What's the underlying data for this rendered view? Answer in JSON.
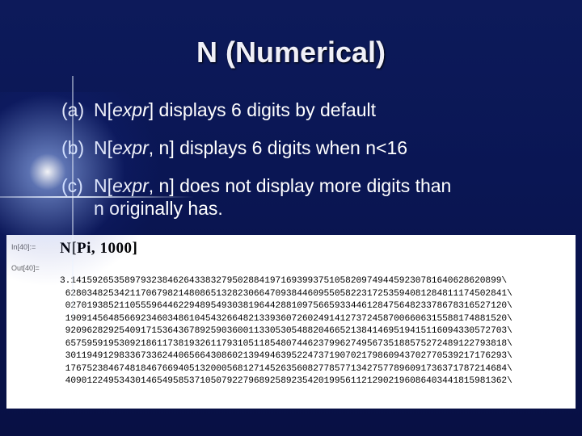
{
  "slide": {
    "title": "N (Numerical)",
    "bullets": {
      "a": {
        "label": "(a)",
        "pre": "N[",
        "expr": "expr",
        "post": "] displays 6 digits by default"
      },
      "b": {
        "label": "(b)",
        "pre": "N[",
        "expr": "expr",
        "post": ", n] displays 6 digits when n<16"
      },
      "c": {
        "label": "(c)",
        "pre": "N[",
        "expr": "expr",
        "post": ", n] does not display more digits than",
        "cont": "n originally has."
      }
    }
  },
  "notebook": {
    "in_label": "In[40]:=",
    "in_code_pre": "N[Pi, ",
    "in_code_n": "1000",
    "in_code_post": "]",
    "out_label": "Out[40]=",
    "out_lines": [
      "3.14159265358979323846264338327950288419716939937510582097494459230781640628620899\\",
      " 6280348253421170679821480865132823066470938446095505822317253594081284811174502841\\",
      " 0270193852110555964462294895493038196442881097566593344612847564823378678316527120\\",
      " 1909145648566923460348610454326648213393607260249141273724587006606315588174881520\\",
      " 9209628292540917153643678925903600113305305488204665213841469519415116094330572703\\",
      " 6575959195309218611738193261179310511854807446237996274956735188575272489122793818\\",
      " 3011949129833673362440656643086021394946395224737190702179860943702770539217176293\\",
      " 1767523846748184676694051320005681271452635608277857713427577896091736371787214684\\",
      " 4090122495343014654958537105079227968925892354201995611212902196086403441815981362\\"
    ]
  }
}
